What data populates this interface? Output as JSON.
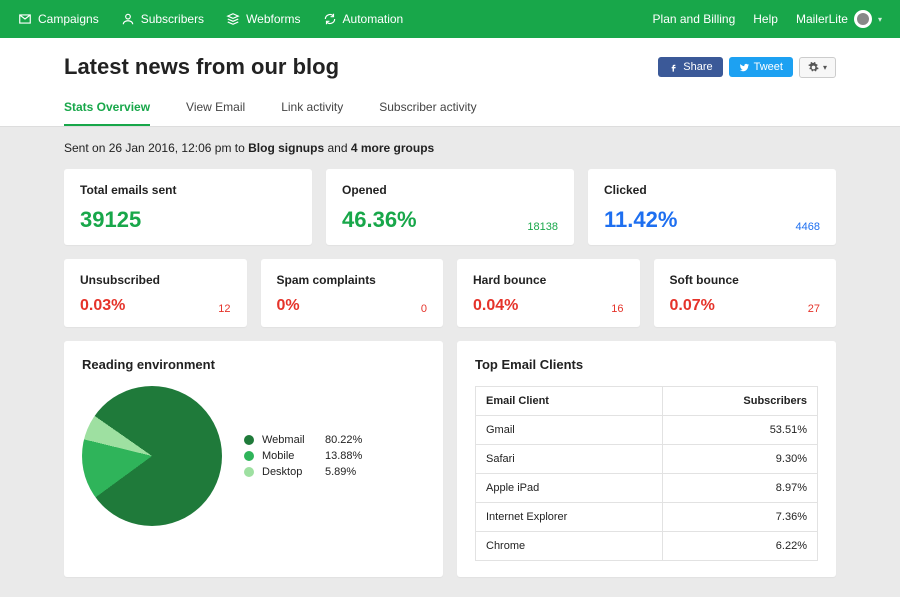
{
  "nav": {
    "campaigns": "Campaigns",
    "subscribers": "Subscribers",
    "webforms": "Webforms",
    "automation": "Automation",
    "plan_billing": "Plan and Billing",
    "help": "Help",
    "brand": "MailerLite"
  },
  "header": {
    "title": "Latest news from our blog",
    "share": "Share",
    "tweet": "Tweet"
  },
  "tabs": {
    "overview": "Stats Overview",
    "view_email": "View Email",
    "link_activity": "Link activity",
    "subscriber_activity": "Subscriber activity"
  },
  "sent_line": {
    "prefix": "Sent on 26 Jan 2016, 12:06 pm to ",
    "group": "Blog signups",
    "mid": " and ",
    "more": "4 more groups"
  },
  "stats": {
    "total_sent": {
      "label": "Total emails sent",
      "value": "39125"
    },
    "opened": {
      "label": "Opened",
      "value": "46.36%",
      "count": "18138"
    },
    "clicked": {
      "label": "Clicked",
      "value": "11.42%",
      "count": "4468"
    },
    "unsubscribed": {
      "label": "Unsubscribed",
      "value": "0.03%",
      "count": "12"
    },
    "spam": {
      "label": "Spam complaints",
      "value": "0%",
      "count": "0"
    },
    "hard_bounce": {
      "label": "Hard bounce",
      "value": "0.04%",
      "count": "16"
    },
    "soft_bounce": {
      "label": "Soft bounce",
      "value": "0.07%",
      "count": "27"
    }
  },
  "reading_env": {
    "title": "Reading environment",
    "legend": [
      {
        "label": "Webmail",
        "pct": "80.22%",
        "color": "#1f7a3a"
      },
      {
        "label": "Mobile",
        "pct": "13.88%",
        "color": "#2fb45a"
      },
      {
        "label": "Desktop",
        "pct": "5.89%",
        "color": "#9ee0a1"
      }
    ]
  },
  "top_clients": {
    "title": "Top Email Clients",
    "col1": "Email Client",
    "col2": "Subscribers",
    "rows": [
      {
        "name": "Gmail",
        "pct": "53.51%"
      },
      {
        "name": "Safari",
        "pct": "9.30%"
      },
      {
        "name": "Apple iPad",
        "pct": "8.97%"
      },
      {
        "name": "Internet Explorer",
        "pct": "7.36%"
      },
      {
        "name": "Chrome",
        "pct": "6.22%"
      }
    ]
  },
  "chart_data": {
    "type": "pie",
    "title": "Reading environment",
    "categories": [
      "Webmail",
      "Mobile",
      "Desktop"
    ],
    "values": [
      80.22,
      13.88,
      5.89
    ],
    "colors": [
      "#1f7a3a",
      "#2fb45a",
      "#9ee0a1"
    ]
  }
}
